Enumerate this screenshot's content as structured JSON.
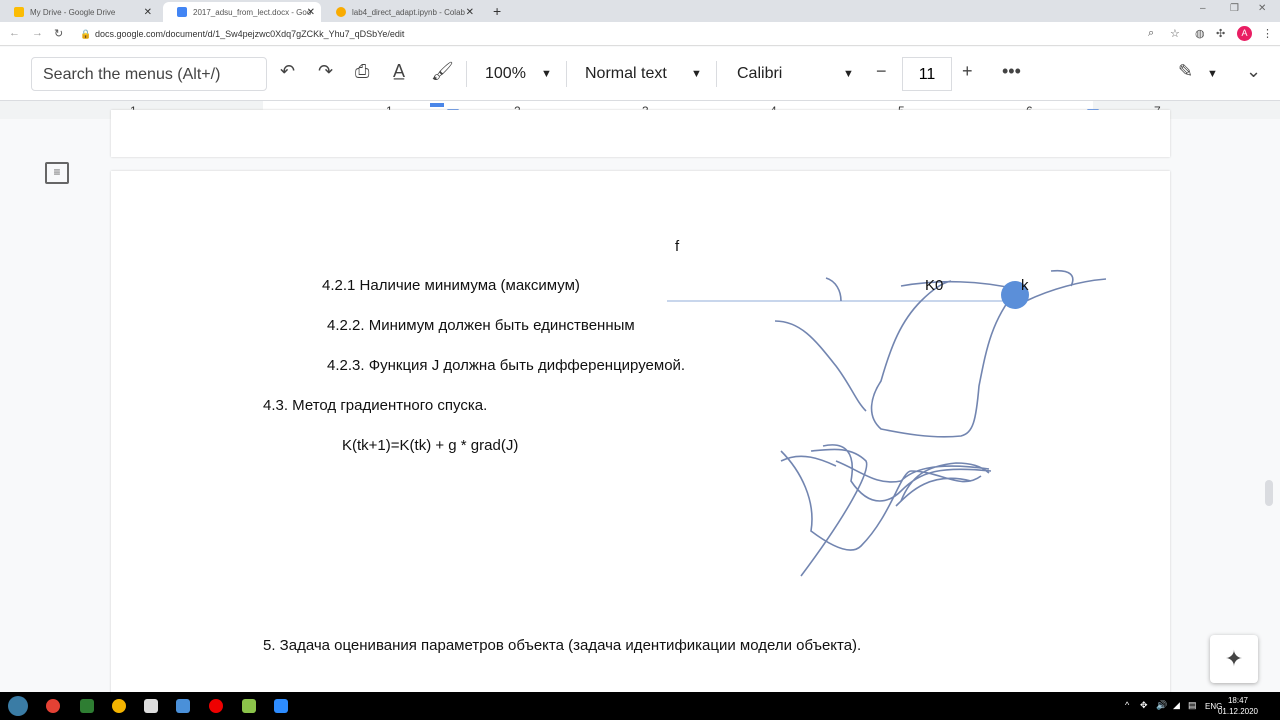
{
  "browser": {
    "tabs": [
      {
        "title": "My Drive - Google Drive",
        "color": "#fbbc04"
      },
      {
        "title": "2017_adsu_from_lect.docx - Goo",
        "color": "#4285f4"
      },
      {
        "title": "lab4_direct_adapt.ipynb - Colab",
        "color": "#f9ab00"
      }
    ],
    "url": "docs.google.com/document/d/1_Sw4pejzwc0Xdq7gZCKk_Yhu7_qDSbYe/edit"
  },
  "toolbar": {
    "search_placeholder": "Search the menus (Alt+/)",
    "zoom": "100%",
    "style": "Normal text",
    "font": "Calibri",
    "font_size": "11"
  },
  "ruler": [
    "1",
    "1",
    "2",
    "3",
    "4",
    "5",
    "6",
    "7"
  ],
  "document": {
    "lines": [
      "4.2.1 Наличие минимума (максимум)",
      "4.2.2. Минимум должен быть единственным",
      "4.2.3. Функция J должна быть дифференцируемой.",
      "4.3. Метод градиентного спуска.",
      "K(tk+1)=K(tk) + g * grad(J)",
      "5. Задача оценивания параметров объекта (задача идентификации модели объекта)."
    ],
    "drawing_labels": {
      "f": "f",
      "k0": "K0",
      "k": "k"
    }
  },
  "taskbar": {
    "lang": "ENG",
    "time": "18:47",
    "date": "01.12.2020"
  }
}
